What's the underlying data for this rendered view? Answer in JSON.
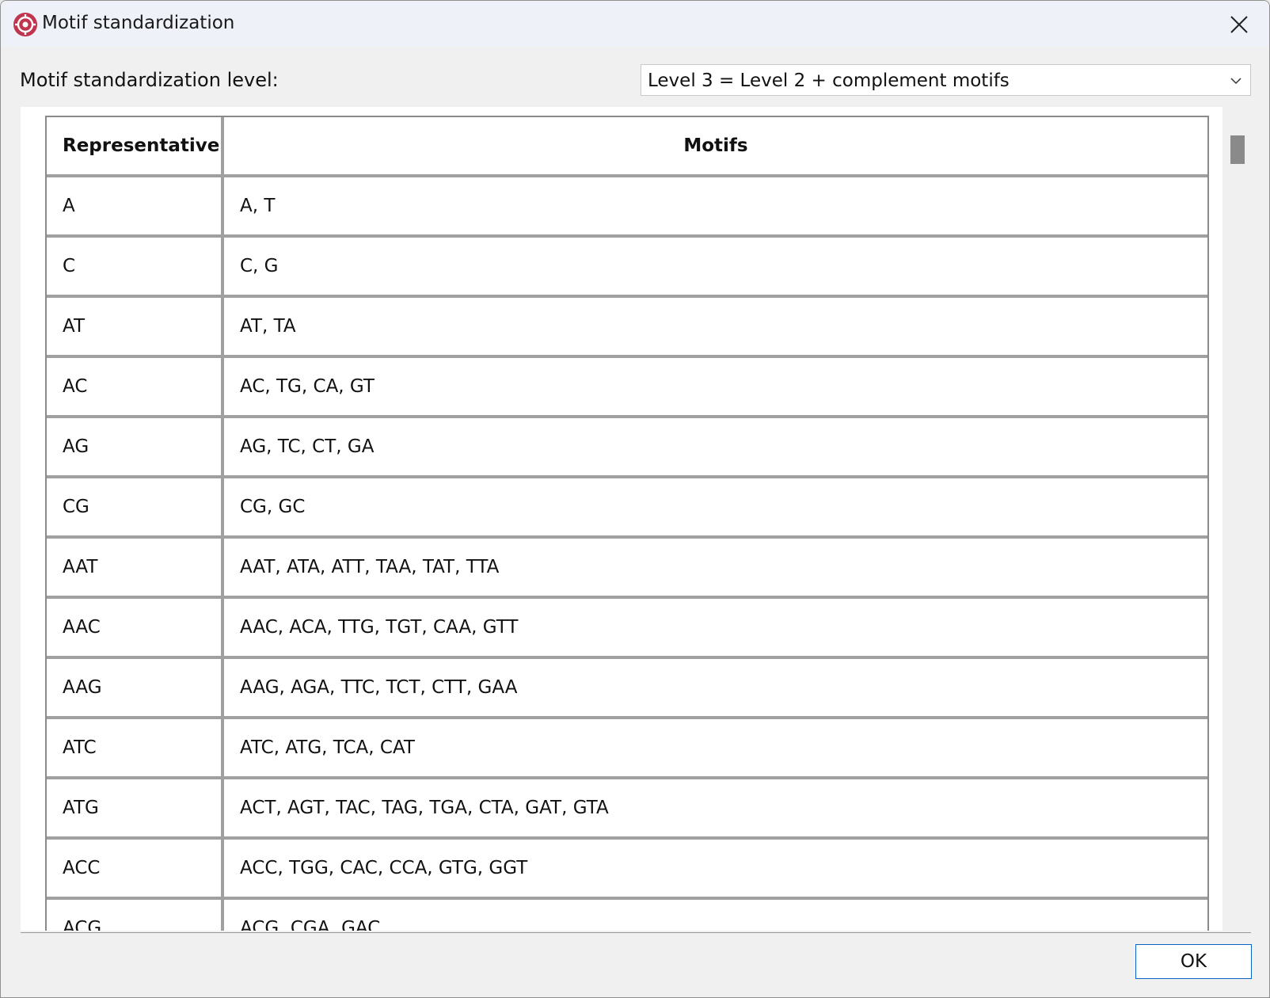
{
  "window": {
    "title": "Motif standardization",
    "icon": "app-logo-icon",
    "close_icon": "close-icon"
  },
  "level": {
    "label": "Motif standardization level:",
    "selected": "Level 3 = Level 2 + complement motifs"
  },
  "table": {
    "headers": [
      "Representative",
      "Motifs"
    ],
    "rows": [
      [
        "A",
        "A, T"
      ],
      [
        "C",
        "C, G"
      ],
      [
        "AT",
        "AT, TA"
      ],
      [
        "AC",
        "AC, TG, CA, GT"
      ],
      [
        "AG",
        "AG, TC, CT, GA"
      ],
      [
        "CG",
        "CG, GC"
      ],
      [
        "AAT",
        "AAT, ATA, ATT, TAA, TAT, TTA"
      ],
      [
        "AAC",
        "AAC, ACA, TTG, TGT, CAA, GTT"
      ],
      [
        "AAG",
        "AAG, AGA, TTC, TCT, CTT, GAA"
      ],
      [
        "ATC",
        "ATC, ATG, TCA, CAT"
      ],
      [
        "ATG",
        "ACT, AGT, TAC, TAG, TGA, CTA, GAT, GTA"
      ],
      [
        "ACC",
        "ACC, TGG, CAC, CCA, GTG, GGT"
      ],
      [
        "ACG",
        "ACG, CGA, GAC"
      ]
    ]
  },
  "buttons": {
    "ok": "OK"
  },
  "colors": {
    "app_icon": "#c0344d",
    "ok_border": "#0b63c9"
  }
}
